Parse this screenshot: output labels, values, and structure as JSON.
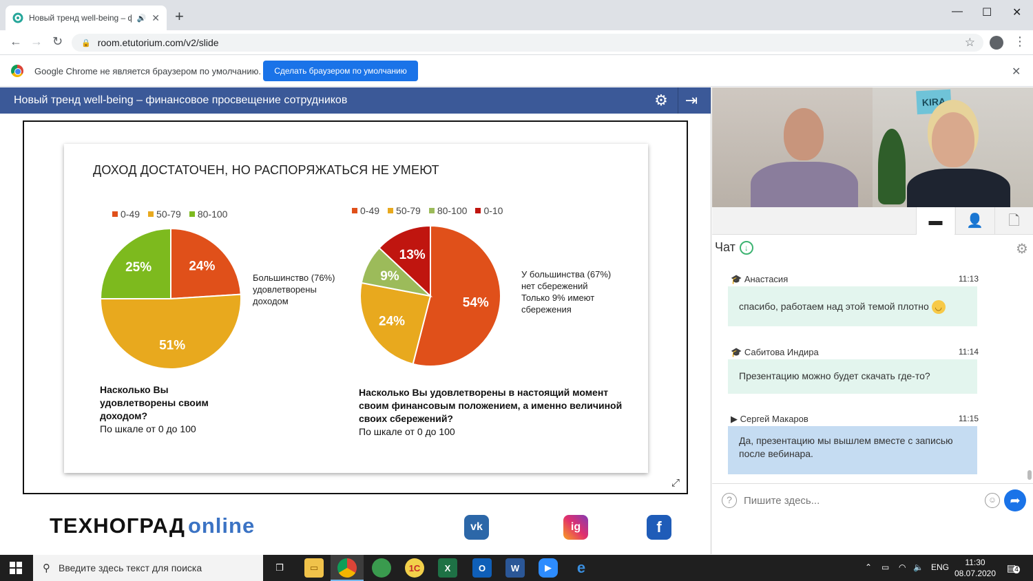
{
  "browser": {
    "tab_title": "Новый тренд well-being – ф",
    "url": "room.etutorium.com/v2/slide",
    "infobar_text": "Google Chrome не является браузером по умолчанию.",
    "infobar_button": "Сделать браузером по умолчанию"
  },
  "app": {
    "title": "Новый тренд well-being – финансовое просвещение сотрудников"
  },
  "slide": {
    "title": "ДОХОД ДОСТАТОЧЕН, НО РАСПОРЯЖАТЬСЯ НЕ УМЕЮТ",
    "left_note": [
      "Большинство (76%)",
      "удовлетворены",
      "доходом"
    ],
    "right_note": [
      "У большинства (67%)",
      "нет сбережений",
      "Только 9% имеют",
      "сбережения"
    ],
    "left_question": [
      "Насколько Вы",
      "удовлетворены своим",
      "доходом?"
    ],
    "left_scale": "По шкале от 0 до 100",
    "right_question": [
      "Насколько Вы удовлетворены в настоящий момент",
      "своим финансовым положением, а именно величиной",
      "своих сбережений?"
    ],
    "right_scale": "По шкале от 0 до 100"
  },
  "chart_data": [
    {
      "type": "pie",
      "categories": [
        "0-49",
        "50-79",
        "80-100"
      ],
      "values": [
        24,
        51,
        25
      ],
      "labels": [
        "24%",
        "51%",
        "25%"
      ],
      "colors": [
        "#e0501a",
        "#e8a91e",
        "#7dba1e"
      ],
      "legend": "top"
    },
    {
      "type": "pie",
      "categories": [
        "0-49",
        "50-79",
        "80-100",
        "0-10"
      ],
      "values": [
        54,
        24,
        9,
        13
      ],
      "labels": [
        "54%",
        "24%",
        "9%",
        "13%"
      ],
      "colors": [
        "#e0501a",
        "#e8a91e",
        "#9cbb5a",
        "#c0150f"
      ],
      "legend": "top"
    }
  ],
  "footer": {
    "logo_text": "ТЕХНОГРАД",
    "logo_suffix": "online",
    "social": [
      "vk",
      "ig",
      "f"
    ]
  },
  "chat": {
    "title": "Чат",
    "messages": [
      {
        "author": "Анастасия",
        "time": "11:13",
        "text": "спасибо, работаем над этой темой плотно"
      },
      {
        "author": "Сабитова Индира",
        "time": "11:14",
        "text": "Презентацию можно будет скачать где-то?"
      },
      {
        "author": "Сергей Макаров",
        "time": "11:15",
        "text": "Да, презентацию мы вышлем вместе с записью после вебинара."
      }
    ],
    "placeholder": "Пишите здесь..."
  },
  "video": {
    "sign_text": "KIRA"
  },
  "taskbar": {
    "search_placeholder": "Введите здесь текст для поиска",
    "lang": "ENG",
    "time": "11:30",
    "date": "08.07.2020",
    "notifications": "4"
  },
  "colors": {
    "header_blue": "#3b5998",
    "chrome_blue": "#1a73e8",
    "chat_green": "#e3f5ee",
    "chat_blue": "#c5dcf2"
  }
}
